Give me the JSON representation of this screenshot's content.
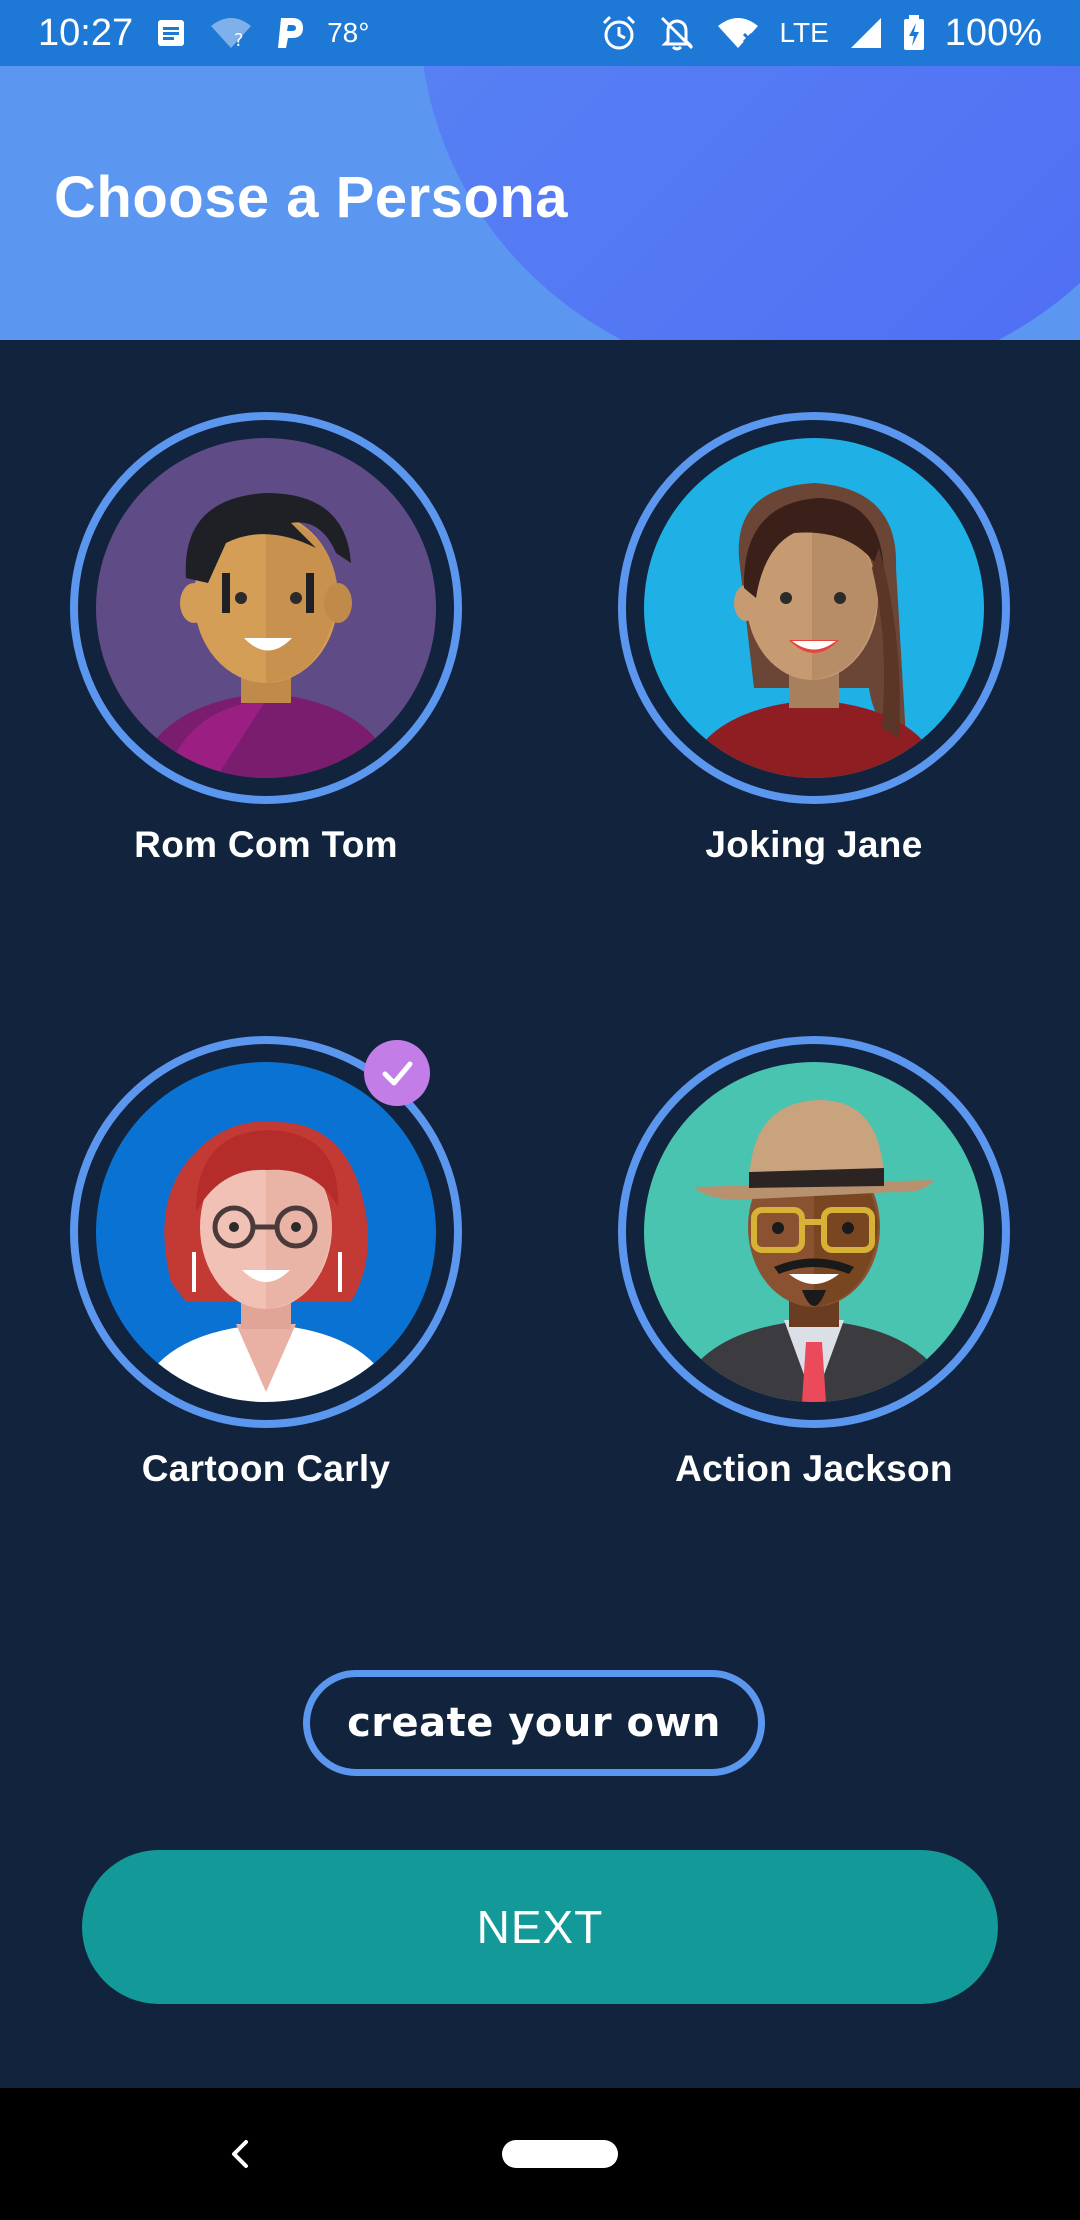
{
  "status_bar": {
    "time": "10:27",
    "temperature": "78°",
    "network": "LTE",
    "battery": "100%",
    "icons": [
      "notes-icon",
      "wifi-question-icon",
      "parking-icon",
      "alarm-icon",
      "notifications-off-icon",
      "wifi-icon",
      "signal-icon",
      "battery-charging-icon"
    ]
  },
  "header": {
    "title": "Choose a Persona"
  },
  "personas": [
    {
      "name": "Rom Com Tom",
      "selected": false
    },
    {
      "name": "Joking Jane",
      "selected": false
    },
    {
      "name": "Cartoon Carly",
      "selected": true
    },
    {
      "name": "Action Jackson",
      "selected": false
    }
  ],
  "actions": {
    "create_label": "create your own",
    "next_label": "NEXT"
  },
  "colors": {
    "background": "#12233d",
    "header": "#5b97f0",
    "ring": "#5c97ef",
    "next_button": "#139a98",
    "selected_badge": "#c27de6"
  }
}
